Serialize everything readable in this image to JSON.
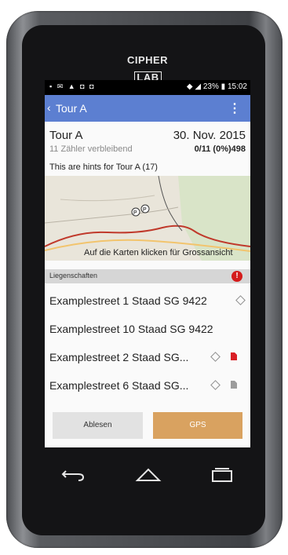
{
  "device": {
    "brand_left": "CIPHER",
    "brand_right": "LAB"
  },
  "statusbar": {
    "battery": "23%",
    "time": "15:02"
  },
  "appbar": {
    "back_title": "Tour A"
  },
  "header": {
    "name": "Tour A",
    "date": "30. Nov. 2015",
    "remaining": "11 Zähler verbleibend",
    "stats": "0/11 (0%)498"
  },
  "hints": "This are hints for Tour A (17)",
  "map": {
    "caption": "Auf die Karten klicken für Grossansicht"
  },
  "section": {
    "label": "Liegenschaften",
    "alert_mark": "!"
  },
  "rows": [
    {
      "address": "Examplestreet 1 Staad SG 9422"
    },
    {
      "address": "Examplestreet 10 Staad SG 9422"
    },
    {
      "address": "Examplestreet 2 Staad SG..."
    },
    {
      "address": "Examplestreet 6 Staad SG..."
    }
  ],
  "buttons": {
    "ablesen": "Ablesen",
    "gps": "GPS"
  },
  "colors": {
    "appbar": "#5c7fd1",
    "gps_button": "#d9a260",
    "alert": "#d41b1b",
    "doc_red": "#d91f26"
  }
}
